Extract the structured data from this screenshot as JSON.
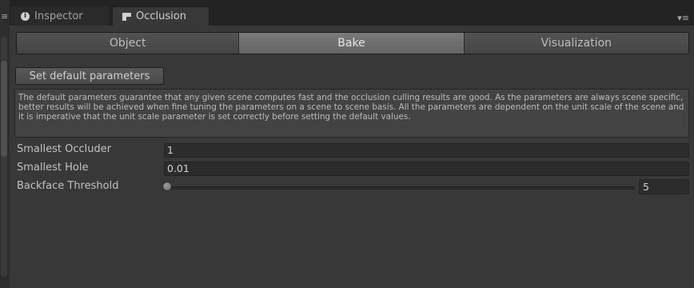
{
  "tabs": {
    "inspector_label": "Inspector",
    "occlusion_label": "Occlusion",
    "inspector_icon": "info-icon",
    "occlusion_icon": "occlusion-window-icon"
  },
  "toolbar": {
    "segments": [
      "Object",
      "Bake",
      "Visualization"
    ],
    "selected": "Bake"
  },
  "bake": {
    "set_default_label": "Set default parameters",
    "help_text": "The default parameters guarantee that any given scene computes fast and the occlusion culling results are good. As the parameters are always scene specific, better results will be achieved when fine tuning the parameters on a scene to scene basis. All the parameters are dependent on the unit scale of the scene and it is imperative that the unit scale parameter is set correctly before setting the default values.",
    "smallest_occluder_label": "Smallest Occluder",
    "smallest_occluder_value": "1",
    "smallest_hole_label": "Smallest Hole",
    "smallest_hole_value": "0.01",
    "backface_threshold_label": "Backface Threshold",
    "backface_threshold_value": "5",
    "backface_threshold_fraction": 0.05
  },
  "colors": {
    "background": "#383838",
    "selected_segment": "#6e6e6e",
    "field_background": "#2c2c2c"
  }
}
